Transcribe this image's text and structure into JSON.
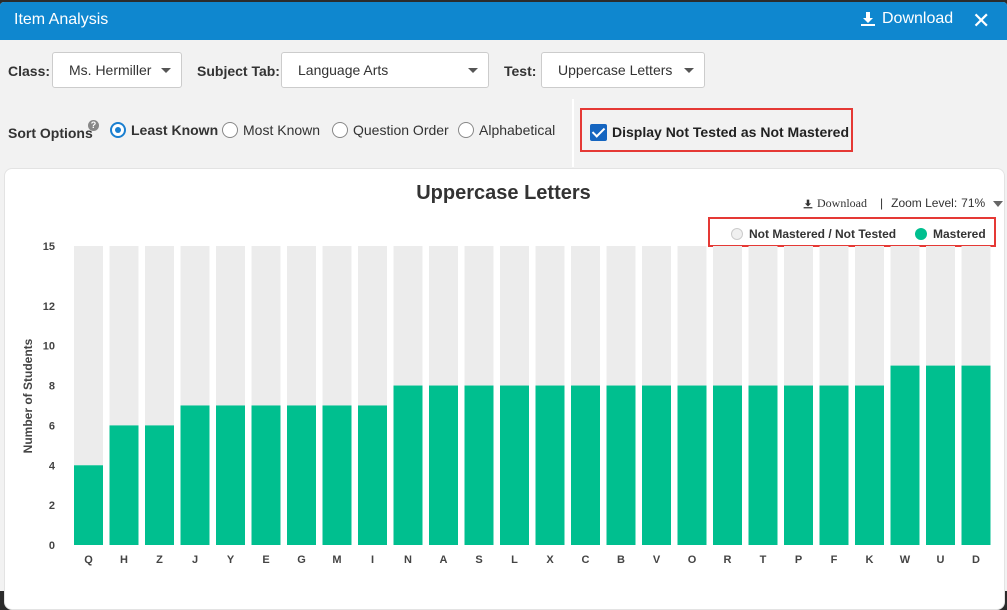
{
  "window": {
    "title": "Item Analysis",
    "download_label": "Download",
    "close_glyph": "✕"
  },
  "filters": {
    "class_label": "Class:",
    "class_value": "Ms. Hermiller",
    "subject_label": "Subject Tab:",
    "subject_value": "Language Arts",
    "test_label": "Test:",
    "test_value": "Uppercase Letters"
  },
  "sort": {
    "label": "Sort Options",
    "help_glyph": "?",
    "options": [
      "Least Known",
      "Most Known",
      "Question Order",
      "Alphabetical"
    ],
    "selected": "Least Known"
  },
  "display_not_tested": {
    "label": "Display Not Tested as Not Mastered",
    "checked": true
  },
  "chart_toolbar": {
    "download_label": "Download",
    "separator": "|",
    "zoom_label": "Zoom Level:",
    "zoom_value": "71%"
  },
  "colors": {
    "accent": "#0f87cf",
    "mastered": "#00bf8f",
    "not_mastered": "#ececec",
    "highlight": "#e53935"
  },
  "chart_data": {
    "type": "bar",
    "title": "Uppercase Letters",
    "xlabel": "",
    "ylabel": "Number of Students",
    "ylim": [
      0,
      15
    ],
    "yticks": [
      0,
      2,
      4,
      6,
      8,
      10,
      12,
      15
    ],
    "categories": [
      "Q",
      "H",
      "Z",
      "J",
      "Y",
      "E",
      "G",
      "M",
      "I",
      "N",
      "A",
      "S",
      "L",
      "X",
      "C",
      "B",
      "V",
      "O",
      "R",
      "T",
      "P",
      "F",
      "K",
      "W",
      "U",
      "D"
    ],
    "series": [
      {
        "name": "Mastered",
        "color": "#00bf8f",
        "values": [
          4,
          6,
          6,
          7,
          7,
          7,
          7,
          7,
          7,
          8,
          8,
          8,
          8,
          8,
          8,
          8,
          8,
          8,
          8,
          8,
          8,
          8,
          8,
          9,
          9,
          9
        ]
      },
      {
        "name": "Not Mastered / Not Tested",
        "color": "#ececec",
        "values": [
          11,
          9,
          9,
          8,
          8,
          8,
          8,
          8,
          8,
          7,
          7,
          7,
          7,
          7,
          7,
          7,
          7,
          7,
          7,
          7,
          7,
          7,
          7,
          6,
          6,
          6
        ]
      }
    ],
    "legend_position": "top-right",
    "grid": false
  }
}
